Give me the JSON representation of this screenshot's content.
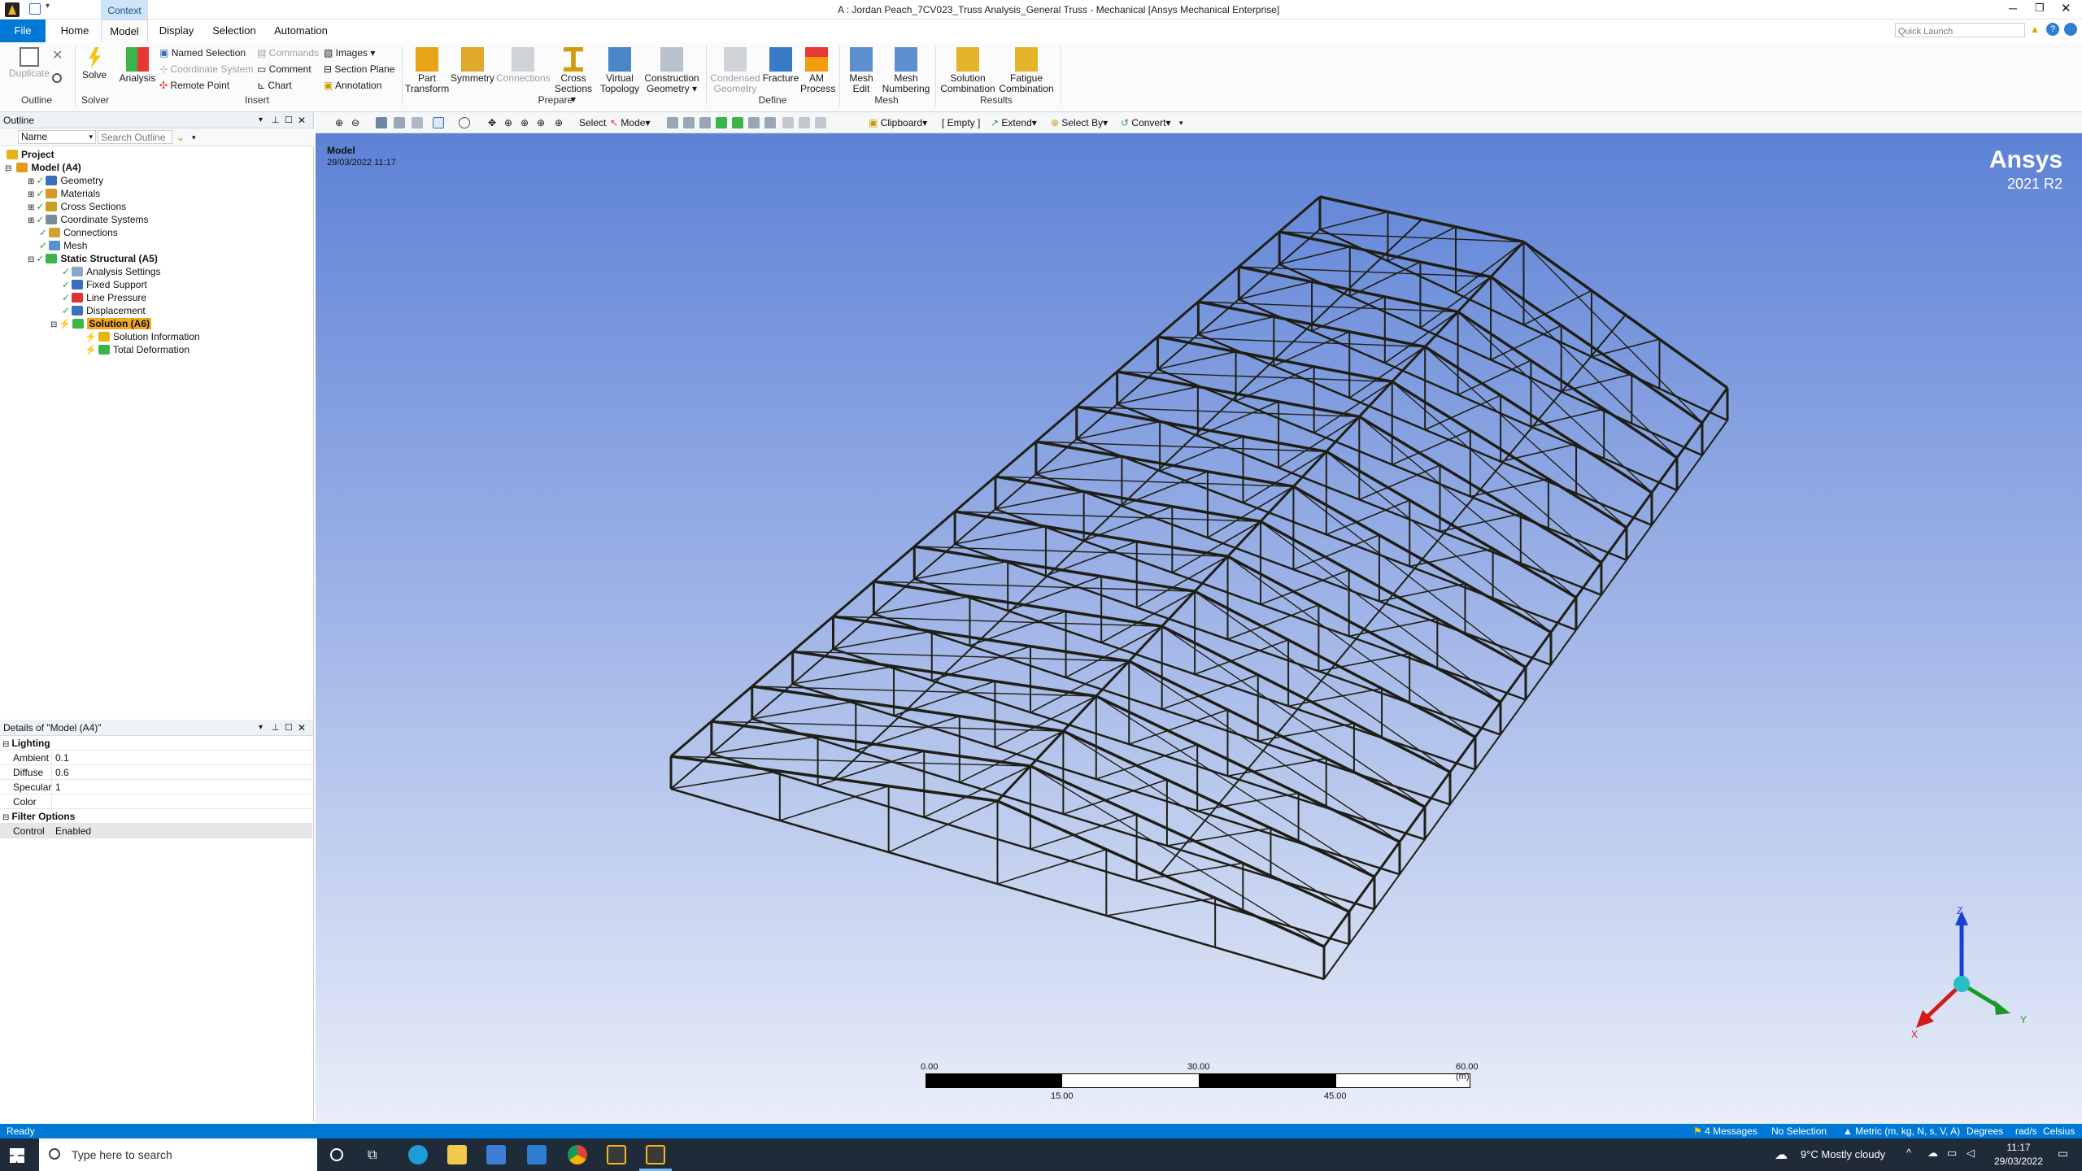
{
  "app": {
    "title": "A : Jordan Peach_7CV023_Truss Analysis_General Truss - Mechanical [Ansys Mechanical Enterprise]",
    "context_tab": "Context",
    "quick_launch_placeholder": "Quick Launch"
  },
  "menu": {
    "file": "File",
    "home": "Home",
    "model": "Model",
    "display": "Display",
    "selection": "Selection",
    "automation": "Automation"
  },
  "ribbon": {
    "duplicate": "Duplicate",
    "outline_group": "Outline",
    "solve": "Solve",
    "solver_group": "Solver",
    "analysis": "Analysis",
    "named_selection": "Named Selection",
    "coordinate_system": "Coordinate System",
    "remote_point": "Remote Point",
    "commands": "Commands",
    "comment": "Comment",
    "chart": "Chart",
    "images": "Images",
    "section_plane": "Section Plane",
    "annotation": "Annotation",
    "insert_group": "Insert",
    "part_transform_1": "Part",
    "part_transform_2": "Transform",
    "symmetry": "Symmetry",
    "connections": "Connections",
    "cross_sections_1": "Cross",
    "cross_sections_2": "Sections",
    "virtual_topology_1": "Virtual",
    "virtual_topology_2": "Topology",
    "construction_geometry_1": "Construction",
    "construction_geometry_2": "Geometry",
    "prepare_group": "Prepare",
    "condensed_geometry_1": "Condensed",
    "condensed_geometry_2": "Geometry",
    "fracture": "Fracture",
    "am_process_1": "AM",
    "am_process_2": "Process",
    "define_group": "Define",
    "mesh_edit_1": "Mesh",
    "mesh_edit_2": "Edit",
    "mesh_numbering_1": "Mesh",
    "mesh_numbering_2": "Numbering",
    "mesh_group": "Mesh",
    "solution_combination_1": "Solution",
    "solution_combination_2": "Combination",
    "fatigue_combination_1": "Fatigue",
    "fatigue_combination_2": "Combination",
    "results_group": "Results"
  },
  "outline": {
    "title": "Outline",
    "filter_name": "Name",
    "search_placeholder": "Search Outline",
    "items": [
      {
        "label": "Project",
        "bold": true
      },
      {
        "label": "Model (A4)",
        "bold": true
      },
      {
        "label": "Geometry"
      },
      {
        "label": "Materials"
      },
      {
        "label": "Cross Sections"
      },
      {
        "label": "Coordinate Systems"
      },
      {
        "label": "Connections"
      },
      {
        "label": "Mesh"
      },
      {
        "label": "Static Structural (A5)",
        "bold": true
      },
      {
        "label": "Analysis Settings"
      },
      {
        "label": "Fixed Support"
      },
      {
        "label": "Line Pressure"
      },
      {
        "label": "Displacement"
      },
      {
        "label": "Solution (A6)",
        "bold": true
      },
      {
        "label": "Solution Information"
      },
      {
        "label": "Total Deformation"
      }
    ]
  },
  "details": {
    "title": "Details of \"Model (A4)\"",
    "lighting": "Lighting",
    "ambient_label": "Ambient",
    "ambient": "0.1",
    "diffuse_label": "Diffuse",
    "diffuse": "0.6",
    "specular_label": "Specular",
    "specular": "1",
    "color_label": "Color",
    "color": "",
    "filter_options": "Filter Options",
    "control_label": "Control",
    "control": "Enabled"
  },
  "viewtoolbar": {
    "select": "Select",
    "mode": "Mode",
    "clipboard": "Clipboard",
    "empty": "[ Empty ]",
    "extend": "Extend",
    "select_by": "Select By",
    "convert": "Convert"
  },
  "viewport": {
    "model_label": "Model",
    "date": "29/03/2022 11:17",
    "brand": "Ansys",
    "version": "2021 R2",
    "scale": {
      "t0": "0.00",
      "t30": "30.00",
      "t60": "60.00 (m)",
      "t15": "15.00",
      "t45": "45.00"
    },
    "triad": {
      "x": "X",
      "y": "Y",
      "z": "Z"
    }
  },
  "status": {
    "ready": "Ready",
    "messages": "4 Messages",
    "selection": "No Selection",
    "units": "Metric (m, kg, N, s, V, A)",
    "degrees": "Degrees",
    "rads": "rad/s",
    "celsius": "Celsius"
  },
  "taskbar": {
    "search_placeholder": "Type here to search",
    "weather": "9°C  Mostly cloudy",
    "time": "11:17",
    "date": "29/03/2022"
  },
  "colors": {
    "accent": "#0079d6",
    "selected_node": "#f5a623",
    "taskbar": "#202b3a"
  }
}
